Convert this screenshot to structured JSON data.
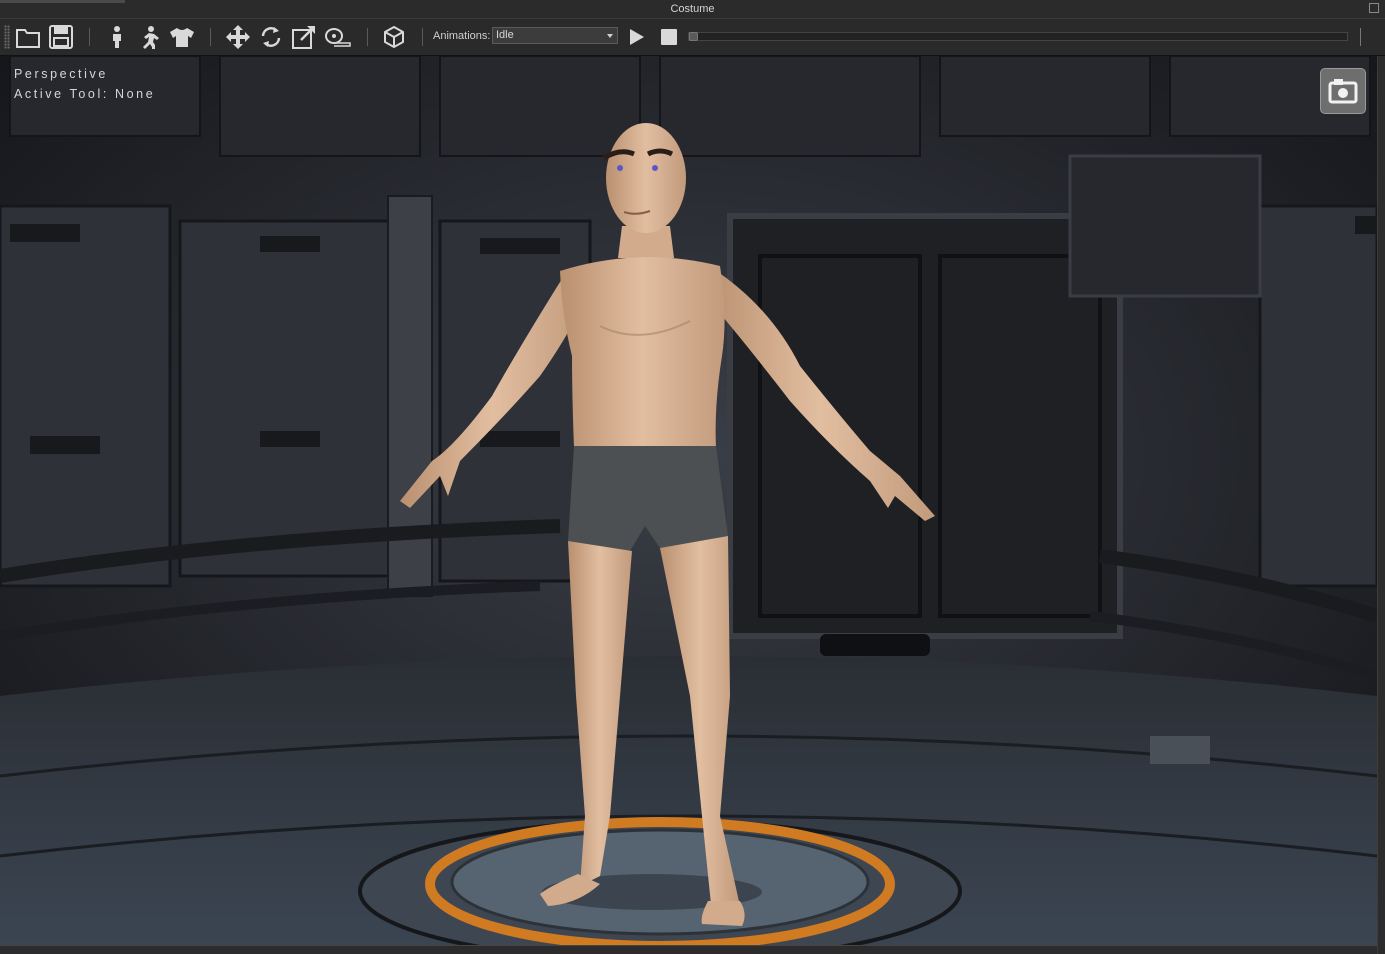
{
  "window": {
    "title": "Costume"
  },
  "toolbar": {
    "buttons": [
      {
        "name": "open-folder",
        "icon": "folder-icon"
      },
      {
        "name": "save",
        "icon": "save-icon"
      },
      {
        "name": "pose-standing",
        "icon": "standing-figure-icon"
      },
      {
        "name": "pose-running",
        "icon": "running-figure-icon"
      },
      {
        "name": "costume",
        "icon": "shirt-icon"
      },
      {
        "name": "move-tool",
        "icon": "move-arrows-icon"
      },
      {
        "name": "rotate-tool",
        "icon": "rotate-icon"
      },
      {
        "name": "scale-tool",
        "icon": "scale-icon"
      },
      {
        "name": "measure-tool",
        "icon": "tape-measure-icon"
      },
      {
        "name": "view-cube",
        "icon": "cube-icon"
      }
    ],
    "animations_label": "Animations:",
    "animation_selected": "Idle",
    "play_icon": "play-icon",
    "stop_icon": "stop-icon",
    "timeline_position": 0
  },
  "viewport": {
    "view_label": "Perspective",
    "active_tool": "Active Tool: None",
    "screenshot_icon": "camera-icon"
  },
  "colors": {
    "skin": "#d9b497",
    "underwear": "#4d5052",
    "platform_ring": "#d07a22",
    "background": "#202227"
  }
}
